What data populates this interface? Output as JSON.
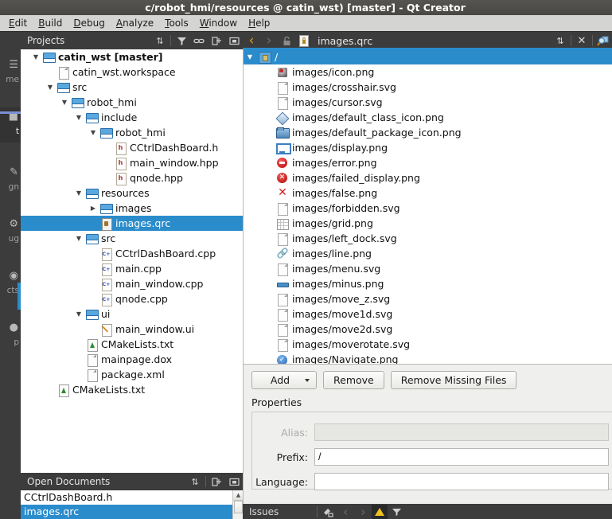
{
  "window": {
    "title": "c/robot_hmi/resources @ catin_wst) [master] - Qt Creator"
  },
  "menubar": {
    "items": [
      {
        "label": "Edit"
      },
      {
        "label": "Build"
      },
      {
        "label": "Debug"
      },
      {
        "label": "Analyze"
      },
      {
        "label": "Tools"
      },
      {
        "label": "Window"
      },
      {
        "label": "Help"
      }
    ]
  },
  "modebar": {
    "items": [
      {
        "label": "me",
        "full": "Welcome"
      },
      {
        "label": "t",
        "full": "Edit"
      },
      {
        "label": "gn",
        "full": "Design"
      },
      {
        "label": "ug",
        "full": "Debug"
      },
      {
        "label": "cts",
        "full": "Projects"
      },
      {
        "label": "p",
        "full": "Help"
      }
    ]
  },
  "projects_pane": {
    "title": "Projects",
    "buttons": [
      {
        "name": "sync-selector",
        "glyph": "⇅"
      },
      {
        "name": "filter-icon",
        "glyph": "▼"
      },
      {
        "name": "link-icon",
        "glyph": "⚭"
      },
      {
        "name": "split-icon",
        "glyph": "⊞"
      },
      {
        "name": "close-icon",
        "glyph": "▣"
      }
    ]
  },
  "tree": {
    "rows": [
      {
        "depth": 0,
        "arrow": "down",
        "icon": "folder",
        "label": "catin_wst [master]",
        "bold": true,
        "selected": false
      },
      {
        "depth": 1,
        "arrow": "none",
        "icon": "doc",
        "label": "catin_wst.workspace",
        "bold": false,
        "selected": false
      },
      {
        "depth": 1,
        "arrow": "down",
        "icon": "folder",
        "label": "src",
        "bold": false,
        "selected": false
      },
      {
        "depth": 2,
        "arrow": "down",
        "icon": "folder",
        "label": "robot_hmi",
        "bold": false,
        "selected": false
      },
      {
        "depth": 3,
        "arrow": "down",
        "icon": "folder",
        "label": "include",
        "bold": false,
        "selected": false
      },
      {
        "depth": 4,
        "arrow": "down",
        "icon": "folder",
        "label": "robot_hmi",
        "bold": false,
        "selected": false
      },
      {
        "depth": 5,
        "arrow": "none",
        "icon": "h",
        "label": "CCtrlDashBoard.h",
        "bold": false,
        "selected": false
      },
      {
        "depth": 5,
        "arrow": "none",
        "icon": "h",
        "label": "main_window.hpp",
        "bold": false,
        "selected": false
      },
      {
        "depth": 5,
        "arrow": "none",
        "icon": "h",
        "label": "qnode.hpp",
        "bold": false,
        "selected": false
      },
      {
        "depth": 3,
        "arrow": "down",
        "icon": "folder",
        "label": "resources",
        "bold": false,
        "selected": false
      },
      {
        "depth": 4,
        "arrow": "right",
        "icon": "folder",
        "label": "images",
        "bold": false,
        "selected": false
      },
      {
        "depth": 4,
        "arrow": "none",
        "icon": "qrc",
        "label": "images.qrc",
        "bold": false,
        "selected": true
      },
      {
        "depth": 3,
        "arrow": "down",
        "icon": "folder",
        "label": "src",
        "bold": false,
        "selected": false
      },
      {
        "depth": 4,
        "arrow": "none",
        "icon": "cpp",
        "label": "CCtrlDashBoard.cpp",
        "bold": false,
        "selected": false
      },
      {
        "depth": 4,
        "arrow": "none",
        "icon": "cpp",
        "label": "main.cpp",
        "bold": false,
        "selected": false
      },
      {
        "depth": 4,
        "arrow": "none",
        "icon": "cpp",
        "label": "main_window.cpp",
        "bold": false,
        "selected": false
      },
      {
        "depth": 4,
        "arrow": "none",
        "icon": "cpp",
        "label": "qnode.cpp",
        "bold": false,
        "selected": false
      },
      {
        "depth": 3,
        "arrow": "down",
        "icon": "folder",
        "label": "ui",
        "bold": false,
        "selected": false
      },
      {
        "depth": 4,
        "arrow": "none",
        "icon": "ui",
        "label": "main_window.ui",
        "bold": false,
        "selected": false
      },
      {
        "depth": 3,
        "arrow": "none",
        "icon": "cmake",
        "label": "CMakeLists.txt",
        "bold": false,
        "selected": false
      },
      {
        "depth": 3,
        "arrow": "none",
        "icon": "doc",
        "label": "mainpage.dox",
        "bold": false,
        "selected": false
      },
      {
        "depth": 3,
        "arrow": "none",
        "icon": "doc",
        "label": "package.xml",
        "bold": false,
        "selected": false
      },
      {
        "depth": 1,
        "arrow": "none",
        "icon": "cmake",
        "label": "CMakeLists.txt",
        "bold": false,
        "selected": false
      }
    ]
  },
  "open_documents": {
    "title": "Open Documents",
    "buttons": [
      {
        "name": "sync-selector",
        "glyph": "⇅"
      },
      {
        "name": "split-icon",
        "glyph": "⊞"
      },
      {
        "name": "close-icon",
        "glyph": "▣"
      }
    ],
    "items": [
      {
        "label": "CCtrlDashBoard.h",
        "selected": false
      },
      {
        "label": "images.qrc",
        "selected": true
      }
    ]
  },
  "editor_toolbar": {
    "back_glyph": "‹",
    "forward_glyph": "›",
    "lock_glyph": "⚿",
    "document_name": "images.qrc",
    "split_glyph": "⇅",
    "close_glyph": "✕",
    "inspect_glyph": "⚒"
  },
  "resource_list": {
    "root": {
      "label": "/",
      "icon": "prefix",
      "selected": true
    },
    "files": [
      {
        "label": "images/icon.png",
        "icon": "app"
      },
      {
        "label": "images/crosshair.svg",
        "icon": "doc"
      },
      {
        "label": "images/cursor.svg",
        "icon": "doc"
      },
      {
        "label": "images/default_class_icon.png",
        "icon": "diamond"
      },
      {
        "label": "images/default_package_icon.png",
        "icon": "pkg"
      },
      {
        "label": "images/display.png",
        "icon": "display"
      },
      {
        "label": "images/error.png",
        "icon": "error"
      },
      {
        "label": "images/failed_display.png",
        "icon": "failed"
      },
      {
        "label": "images/false.png",
        "icon": "false"
      },
      {
        "label": "images/forbidden.svg",
        "icon": "doc"
      },
      {
        "label": "images/grid.png",
        "icon": "grid"
      },
      {
        "label": "images/left_dock.svg",
        "icon": "doc"
      },
      {
        "label": "images/line.png",
        "icon": "link"
      },
      {
        "label": "images/menu.svg",
        "icon": "doc"
      },
      {
        "label": "images/minus.png",
        "icon": "minus"
      },
      {
        "label": "images/move_z.svg",
        "icon": "doc"
      },
      {
        "label": "images/move1d.svg",
        "icon": "doc"
      },
      {
        "label": "images/move2d.svg",
        "icon": "doc"
      },
      {
        "label": "images/moverotate.svg",
        "icon": "doc"
      },
      {
        "label": "images/Navigate.png",
        "icon": "nav"
      }
    ]
  },
  "bottom_panel": {
    "buttons": {
      "add": "Add",
      "remove": "Remove",
      "remove_missing": "Remove Missing Files"
    },
    "properties_title": "Properties",
    "fields": [
      {
        "label": "Alias:",
        "value": "",
        "placeholder": "",
        "disabled": true
      },
      {
        "label": "Prefix:",
        "value": "/",
        "placeholder": "",
        "disabled": false
      },
      {
        "label": "Language:",
        "value": "",
        "placeholder": "",
        "disabled": false
      }
    ]
  },
  "issues_bar": {
    "title": "Issues",
    "buttons": [
      {
        "name": "clear-icon",
        "glyph": "⚒"
      },
      {
        "name": "prev-issue-icon",
        "glyph": "‹"
      },
      {
        "name": "next-issue-icon",
        "glyph": "›"
      },
      {
        "name": "warning-filter-icon",
        "glyph": "⚠"
      },
      {
        "name": "filter-icon",
        "glyph": "▼"
      }
    ]
  },
  "colors": {
    "titlebar": "#4a4844",
    "menubar": "#d4d4d2",
    "panel_dark": "#3c3c3c",
    "selection": "#2b8ccc",
    "list_bg": "#ffffff",
    "bottom_bg": "#efefed",
    "warning": "#f0c020"
  }
}
